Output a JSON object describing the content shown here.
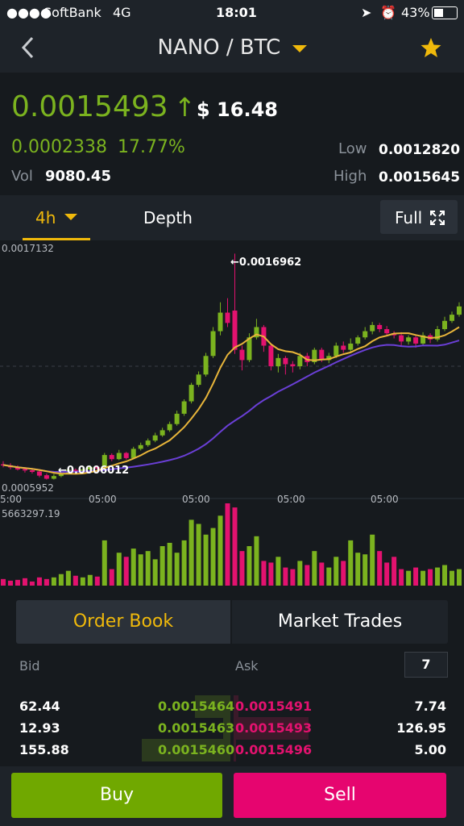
{
  "status_bar": {
    "carrier": "SoftBank",
    "network": "4G",
    "time": "18:01",
    "battery": "43%"
  },
  "header": {
    "pair": "NANO / BTC",
    "back_icon": "chevron-left-icon",
    "favorite_icon": "star-icon"
  },
  "ticker": {
    "last_price": "0.0015493",
    "arrow": "↑",
    "usd_price": "$ 16.48",
    "change_abs": "0.0002338",
    "change_pct": "17.77%",
    "vol_label": "Vol",
    "vol_value": "9080.45",
    "low_label": "Low",
    "low_value": "0.0012820",
    "high_label": "High",
    "high_value": "0.0015645"
  },
  "tabs": {
    "interval": "4h",
    "depth": "Depth",
    "full": "Full"
  },
  "chart_data": {
    "type": "candlestick",
    "price_axis_top": "0.0017132",
    "price_axis_bottom": "0.0005952",
    "high_annotation": "0.0016962",
    "low_annotation": "0.0006012",
    "time_labels": [
      "5:00",
      "05:00",
      "05:00",
      "05:00",
      "05:00"
    ],
    "volume_max_label": "5663297.19",
    "ylim": [
      0.0005952,
      0.0017132
    ],
    "candles": [
      [
        0.000675,
        0.000672,
        0.00069,
        0.00066
      ],
      [
        0.00067,
        0.00066,
        0.00068,
        0.00065
      ],
      [
        0.00066,
        0.00065,
        0.00067,
        0.000645
      ],
      [
        0.000652,
        0.000645,
        0.00066,
        0.000635
      ],
      [
        0.000646,
        0.000638,
        0.000655,
        0.00063
      ],
      [
        0.00064,
        0.00062,
        0.000648,
        0.000612
      ],
      [
        0.000622,
        0.000605,
        0.00063,
        0.000601
      ],
      [
        0.000605,
        0.000618,
        0.000628,
        0.000601
      ],
      [
        0.000618,
        0.000632,
        0.000642,
        0.000612
      ],
      [
        0.000632,
        0.000648,
        0.000656,
        0.000628
      ],
      [
        0.000648,
        0.00064,
        0.000655,
        0.000632
      ],
      [
        0.00064,
        0.00065,
        0.00066,
        0.000635
      ],
      [
        0.00065,
        0.000662,
        0.00067,
        0.000645
      ],
      [
        0.000662,
        0.000655,
        0.00067,
        0.000648
      ],
      [
        0.000655,
        0.00072,
        0.00073,
        0.00065
      ],
      [
        0.00072,
        0.0007,
        0.000728,
        0.00069
      ],
      [
        0.0007,
        0.00073,
        0.000745,
        0.000695
      ],
      [
        0.00073,
        0.000705,
        0.000735,
        0.000698
      ],
      [
        0.000705,
        0.00075,
        0.00076,
        0.0007
      ],
      [
        0.00075,
        0.000768,
        0.00078,
        0.000742
      ],
      [
        0.000768,
        0.00079,
        0.0008,
        0.00076
      ],
      [
        0.00079,
        0.000815,
        0.000828,
        0.000782
      ],
      [
        0.000815,
        0.00084,
        0.000852,
        0.000808
      ],
      [
        0.00084,
        0.00087,
        0.000882,
        0.000832
      ],
      [
        0.00087,
        0.00092,
        0.000935,
        0.000862
      ],
      [
        0.00092,
        0.00098,
        0.00099,
        0.00091
      ],
      [
        0.00098,
        0.00106,
        0.00107,
        0.00097
      ],
      [
        0.00106,
        0.00111,
        0.001125,
        0.00105
      ],
      [
        0.00111,
        0.0012,
        0.001215,
        0.0011
      ],
      [
        0.0012,
        0.00132,
        0.00134,
        0.00119
      ],
      [
        0.00132,
        0.00141,
        0.00146,
        0.0013
      ],
      [
        0.00141,
        0.00136,
        0.00148,
        0.00134
      ],
      [
        0.00142,
        0.00123,
        0.001696,
        0.00121
      ],
      [
        0.00123,
        0.00118,
        0.00125,
        0.00113
      ],
      [
        0.00118,
        0.00129,
        0.00131,
        0.00117
      ],
      [
        0.00129,
        0.00134,
        0.00138,
        0.00128
      ],
      [
        0.00134,
        0.00125,
        0.00135,
        0.00122
      ],
      [
        0.00125,
        0.00115,
        0.00126,
        0.00113
      ],
      [
        0.00115,
        0.00119,
        0.00121,
        0.00112
      ],
      [
        0.00119,
        0.00116,
        0.0012,
        0.00111
      ],
      [
        0.00116,
        0.00115,
        0.001175,
        0.00112
      ],
      [
        0.00115,
        0.0012,
        0.001215,
        0.001135
      ],
      [
        0.0012,
        0.00117,
        0.001215,
        0.00115
      ],
      [
        0.00117,
        0.00123,
        0.00124,
        0.00116
      ],
      [
        0.00123,
        0.00118,
        0.00124,
        0.00117
      ],
      [
        0.00118,
        0.0012,
        0.001215,
        0.001165
      ],
      [
        0.0012,
        0.00125,
        0.001265,
        0.00119
      ],
      [
        0.00125,
        0.00123,
        0.00127,
        0.001215
      ],
      [
        0.00123,
        0.00126,
        0.001285,
        0.00122
      ],
      [
        0.00126,
        0.00129,
        0.0013,
        0.00125
      ],
      [
        0.00129,
        0.00132,
        0.00134,
        0.00128
      ],
      [
        0.00132,
        0.00135,
        0.001365,
        0.001305
      ],
      [
        0.00135,
        0.00133,
        0.00136,
        0.001315
      ],
      [
        0.00133,
        0.00131,
        0.001345,
        0.001295
      ],
      [
        0.00131,
        0.0013,
        0.00132,
        0.001285
      ],
      [
        0.0013,
        0.00127,
        0.001315,
        0.00125
      ],
      [
        0.00127,
        0.00129,
        0.0013,
        0.001255
      ],
      [
        0.00129,
        0.00126,
        0.0013,
        0.00124
      ],
      [
        0.00126,
        0.0013,
        0.001315,
        0.00125
      ],
      [
        0.0013,
        0.00128,
        0.00131,
        0.001262
      ],
      [
        0.00128,
        0.00133,
        0.001345,
        0.00127
      ],
      [
        0.00133,
        0.00137,
        0.00139,
        0.00132
      ],
      [
        0.00137,
        0.0014,
        0.001415,
        0.00136
      ],
      [
        0.0014,
        0.00144,
        0.00146,
        0.00139
      ]
    ],
    "volumes": [
      0.08,
      0.06,
      0.07,
      0.09,
      0.05,
      0.1,
      0.08,
      0.1,
      0.14,
      0.18,
      0.12,
      0.1,
      0.13,
      0.11,
      0.55,
      0.2,
      0.4,
      0.35,
      0.45,
      0.38,
      0.42,
      0.32,
      0.48,
      0.52,
      0.4,
      0.55,
      0.8,
      0.75,
      0.62,
      0.7,
      0.85,
      1.0,
      0.95,
      0.42,
      0.48,
      0.6,
      0.3,
      0.28,
      0.35,
      0.22,
      0.2,
      0.3,
      0.25,
      0.42,
      0.28,
      0.22,
      0.35,
      0.3,
      0.55,
      0.4,
      0.38,
      0.62,
      0.42,
      0.28,
      0.35,
      0.2,
      0.18,
      0.22,
      0.18,
      0.2,
      0.22,
      0.25,
      0.18,
      0.2
    ]
  },
  "orderbook": {
    "tab_active": "Order Book",
    "tab_other": "Market Trades",
    "bid_header": "Bid",
    "ask_header": "Ask",
    "depth_selector": "7",
    "rows": [
      {
        "bid_qty": "62.44",
        "bid_price": "0.0015464",
        "ask_price": "0.0015491",
        "ask_qty": "7.74",
        "bid_fill": 0.15,
        "ask_fill": 0.02
      },
      {
        "bid_qty": "12.93",
        "bid_price": "0.0015463",
        "ask_price": "0.0015493",
        "ask_qty": "126.95",
        "bid_fill": 0.03,
        "ask_fill": 0.32
      },
      {
        "bid_qty": "155.88",
        "bid_price": "0.0015460",
        "ask_price": "0.0015496",
        "ask_qty": "5.00",
        "bid_fill": 0.38,
        "ask_fill": 0.01
      }
    ]
  },
  "actions": {
    "buy": "Buy",
    "sell": "Sell"
  },
  "colors": {
    "up": "#7bb31f",
    "down": "#e3126f",
    "accent": "#f0b90b",
    "ma_fast": "#e8b53a",
    "ma_slow": "#6a3fd6"
  }
}
